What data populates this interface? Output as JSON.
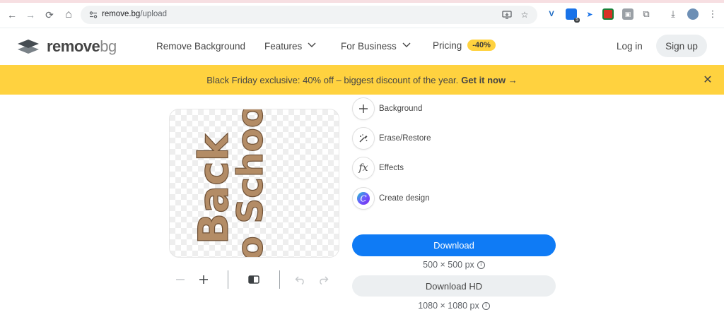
{
  "browser": {
    "url_host": "remove.bg",
    "url_path": "/upload",
    "nav": {
      "back": "←",
      "forward": "→",
      "reload": "⟳",
      "home": "⌂"
    },
    "extension_badge": "5"
  },
  "header": {
    "logo_word1": "remove",
    "logo_word2": "bg",
    "nav_items": [
      {
        "label": "Remove Background"
      },
      {
        "label": "Features"
      },
      {
        "label": "For Business"
      },
      {
        "label": "Pricing"
      }
    ],
    "pricing_badge": "-40%",
    "login": "Log in",
    "signup": "Sign up"
  },
  "banner": {
    "text": "Black Friday exclusive: 40% off – biggest discount of the year.",
    "cta": "Get it now →",
    "close": "✕"
  },
  "preview": {
    "image_text_line1": "Back",
    "image_text_line2": "to School"
  },
  "side_tools": [
    {
      "label": "Background",
      "icon": "plus-icon"
    },
    {
      "label": "Erase/Restore",
      "icon": "brush-icon"
    },
    {
      "label": "Effects",
      "icon": "fx-icon"
    },
    {
      "label": "Create design",
      "icon": "canva-icon"
    }
  ],
  "download": {
    "label": "Download",
    "size": "500 × 500 px",
    "hd_label": "Download HD",
    "hd_size": "1080 × 1080 px"
  },
  "colors": {
    "banner": "#ffd23f",
    "primary": "#0f7bf5"
  }
}
